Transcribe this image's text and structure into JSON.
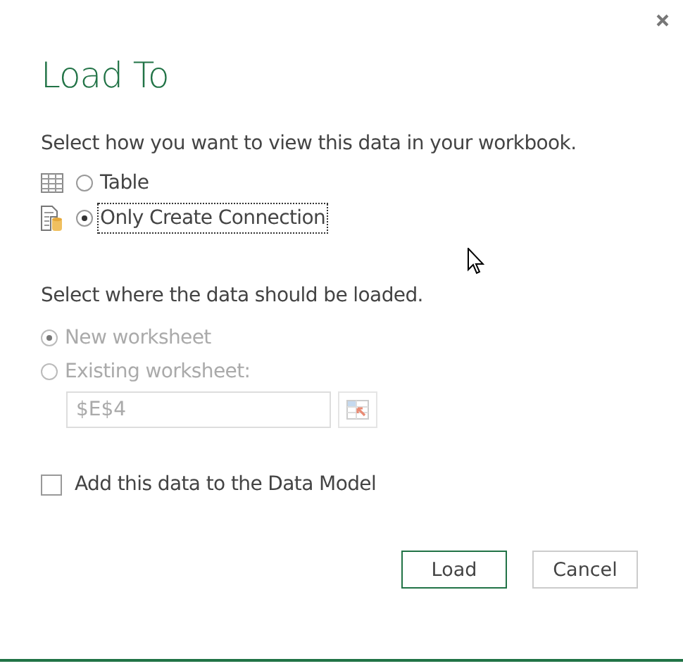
{
  "dialog": {
    "title": "Load To"
  },
  "view": {
    "heading": "Select how you want to view this data in your workbook.",
    "options": [
      {
        "kind": "table",
        "label": "Table",
        "selected": false,
        "focused": false
      },
      {
        "kind": "connection",
        "label": "Only Create Connection",
        "selected": true,
        "focused": true
      }
    ]
  },
  "location": {
    "heading": "Select where the data should be loaded.",
    "disabled": true,
    "options": [
      {
        "label": "New worksheet",
        "selected": true
      },
      {
        "label": "Existing worksheet:",
        "selected": false
      }
    ],
    "reference": {
      "value": "$E$4"
    }
  },
  "data_model": {
    "label": "Add this data to the Data Model",
    "checked": false
  },
  "buttons": [
    {
      "label": "Load",
      "default": true
    },
    {
      "label": "Cancel",
      "default": false
    }
  ]
}
